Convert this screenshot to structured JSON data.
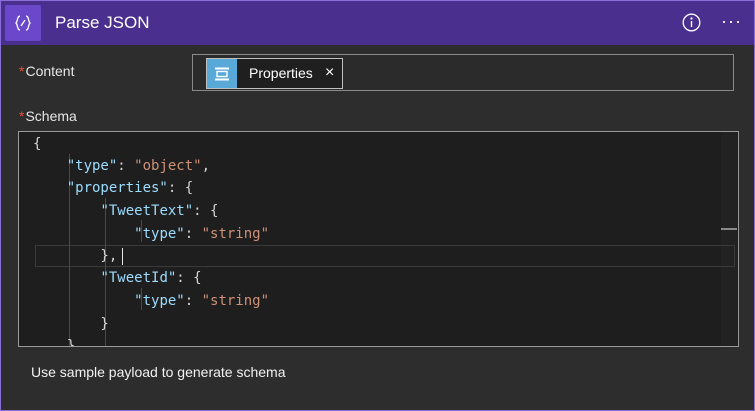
{
  "header": {
    "title": "Parse JSON",
    "app_icon": "braces-icon",
    "info_icon": "info-icon",
    "more_label": "···"
  },
  "content": {
    "required_marker": "*",
    "label": "Content",
    "token": {
      "label": "Properties",
      "icon": "data-operation-icon",
      "close": "×"
    }
  },
  "schema": {
    "required_marker": "*",
    "label": "Schema",
    "lines": [
      "{",
      "    \"type\": \"object\",",
      "    \"properties\": {",
      "        \"TweetText\": {",
      "            \"type\": \"string\"",
      "        },",
      "        \"TweetId\": {",
      "            \"type\": \"string\"",
      "        }",
      "    }"
    ]
  },
  "sample_link": "Use sample payload to generate schema",
  "colors": {
    "header": "#4b2f8f",
    "accent": "#6b47c9",
    "token_icon": "#58a8d8",
    "required": "#e8503a"
  }
}
